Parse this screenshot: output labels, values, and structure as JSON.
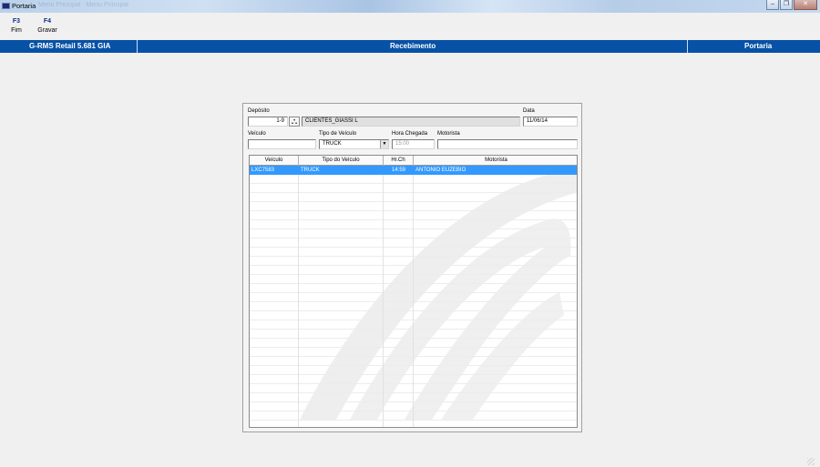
{
  "window": {
    "title": "Portaria",
    "ghost_text": "Menu Principal · Menu Principal"
  },
  "fkeys": [
    {
      "key": "F3",
      "label": "Fim"
    },
    {
      "key": "F4",
      "label": "Gravar"
    }
  ],
  "header": {
    "left": "G-RMS Retail 5.681 GIA",
    "center": "Recebimento",
    "right": "Portaria"
  },
  "form": {
    "deposito_label": "Depósito",
    "deposito_code": "1-9",
    "deposito_name": "CLIENTES_GIASSI L",
    "data_label": "Data",
    "data_value": "11/06/14",
    "veiculo_label": "Veículo",
    "veiculo_value": "",
    "tipo_label": "Tipo de Veículo",
    "tipo_value": "TRUCK",
    "hora_label": "Hora Chegada",
    "hora_value": "15:00",
    "motorista_label": "Motorista",
    "motorista_value": ""
  },
  "grid": {
    "columns": [
      "Veículo",
      "Tipo do Veículo",
      "Hr.Ch",
      "Motorista"
    ],
    "rows": [
      {
        "veiculo": "LXC7583",
        "tipo": "TRUCK",
        "hora": "14:59",
        "motorista": "ANTONIO EUZEBIO"
      }
    ]
  },
  "colors": {
    "header_bg": "#0751a6",
    "selection": "#3399ff",
    "fkey_text": "#0d2f8a"
  }
}
